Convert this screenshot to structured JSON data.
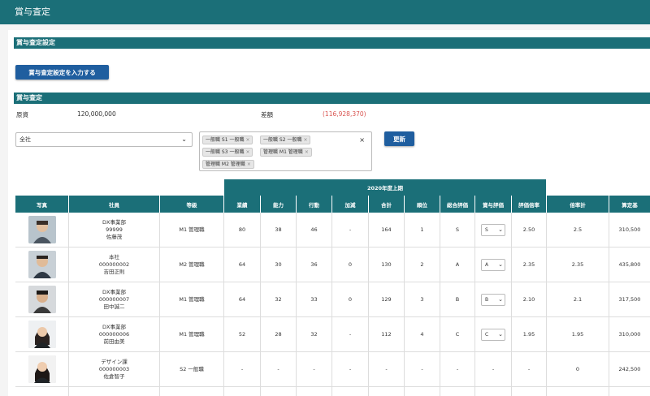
{
  "page": {
    "title": "賞与査定"
  },
  "settings_section": {
    "title": "賞与査定設定",
    "button_label": "賞与査定設定を入力する"
  },
  "assessment_section": {
    "title": "賞与査定"
  },
  "stats": [
    {
      "label": "原資",
      "value": "120,000,000"
    },
    {
      "label": "差額",
      "value": "(116,928,370)",
      "color": "#d9534f"
    }
  ],
  "filters": {
    "scope_select": "全社",
    "tags": [
      "一般職 S1 一般職",
      "一般職 S2 一般職",
      "一般職 S3 一般職",
      "管理職 M1 管理職",
      "管理職 M2 管理職"
    ],
    "clear_icon": "×",
    "tag_remove_icon": "×",
    "update_label": "更新"
  },
  "table": {
    "period": "2020年度上期",
    "headers": [
      "写真",
      "社員",
      "等級",
      "業績",
      "能力",
      "行動",
      "加減",
      "合計",
      "順位",
      "総合評価",
      "賞与評価",
      "評価倍率",
      "倍率計",
      "算定基"
    ],
    "rows": [
      {
        "org": "DX事業部",
        "code": "99999",
        "name": "佐藤茂",
        "grade": "M1 管理職",
        "perf": "80",
        "ability": "38",
        "behavior": "46",
        "adjust": "-",
        "total": "164",
        "rank": "1",
        "overall": "S",
        "bonus_eval": "S",
        "rate": "2.50",
        "rate_total": "2.5",
        "base": "310,500"
      },
      {
        "org": "本社",
        "code": "000000002",
        "name": "吉田正則",
        "grade": "M2 管理職",
        "perf": "64",
        "ability": "30",
        "behavior": "36",
        "adjust": "0",
        "total": "130",
        "rank": "2",
        "overall": "A",
        "bonus_eval": "A",
        "rate": "2.35",
        "rate_total": "2.35",
        "base": "435,800"
      },
      {
        "org": "DX事業部",
        "code": "000000007",
        "name": "田中誠二",
        "grade": "M1 管理職",
        "perf": "64",
        "ability": "32",
        "behavior": "33",
        "adjust": "0",
        "total": "129",
        "rank": "3",
        "overall": "B",
        "bonus_eval": "B",
        "rate": "2.10",
        "rate_total": "2.1",
        "base": "317,500"
      },
      {
        "org": "DX事業部",
        "code": "000000006",
        "name": "前田由美",
        "grade": "M1 管理職",
        "perf": "52",
        "ability": "28",
        "behavior": "32",
        "adjust": "-",
        "total": "112",
        "rank": "4",
        "overall": "C",
        "bonus_eval": "C",
        "rate": "1.95",
        "rate_total": "1.95",
        "base": "310,000"
      },
      {
        "org": "デザイン課",
        "code": "000000003",
        "name": "佐倉智子",
        "grade": "S2 一般職",
        "perf": "-",
        "ability": "-",
        "behavior": "-",
        "adjust": "-",
        "total": "-",
        "rank": "-",
        "overall": "-",
        "bonus_eval": "-",
        "rate": "-",
        "rate_total": "0",
        "base": "242,500"
      }
    ]
  },
  "icons": {
    "chevron": "chevron-down-icon",
    "avatar": "person-photo"
  },
  "colors": {
    "header": "#1b6f78",
    "button": "#1f5e9f",
    "negative": "#d9534f"
  }
}
